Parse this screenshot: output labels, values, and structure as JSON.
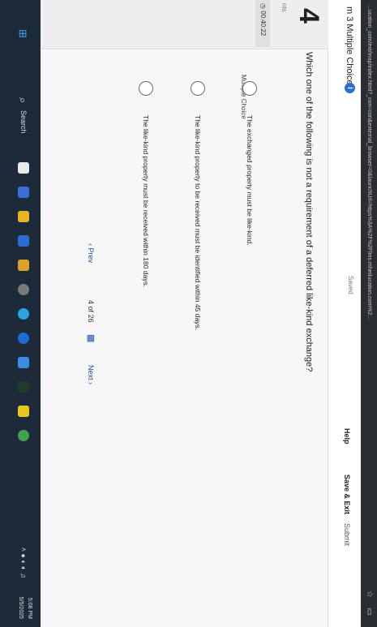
{
  "browser": {
    "url_text": "...ucation_com/ext/map/index.html?_con=con&external_browser=0&launchUrl=https%3A%2F%2Flms.mheducation.com%2..."
  },
  "header": {
    "exam_title": "m 3 Multiple Choice",
    "saved": "Saved",
    "help": "Help",
    "save_exit": "Save & Exit",
    "submit": "Submit"
  },
  "sidebar": {
    "question_number": "4",
    "points": "nts",
    "timer": "00:40:22"
  },
  "question": {
    "text": "Which one of the following is not a requirement of a deferred like-kind exchange?",
    "type_label": "Multiple Choice",
    "options": [
      "The like-kind property must be received within 180 days.",
      "The like-kind property to be received must be identified within 45 days.",
      "The exchanged property must be like-kind."
    ]
  },
  "navigation": {
    "prev": "Prev",
    "page_current": "4",
    "page_of": "of",
    "page_total": "26",
    "next": "Next"
  },
  "taskbar": {
    "search": "Search",
    "time": "5:08 PM",
    "date": "5/5/2025"
  }
}
